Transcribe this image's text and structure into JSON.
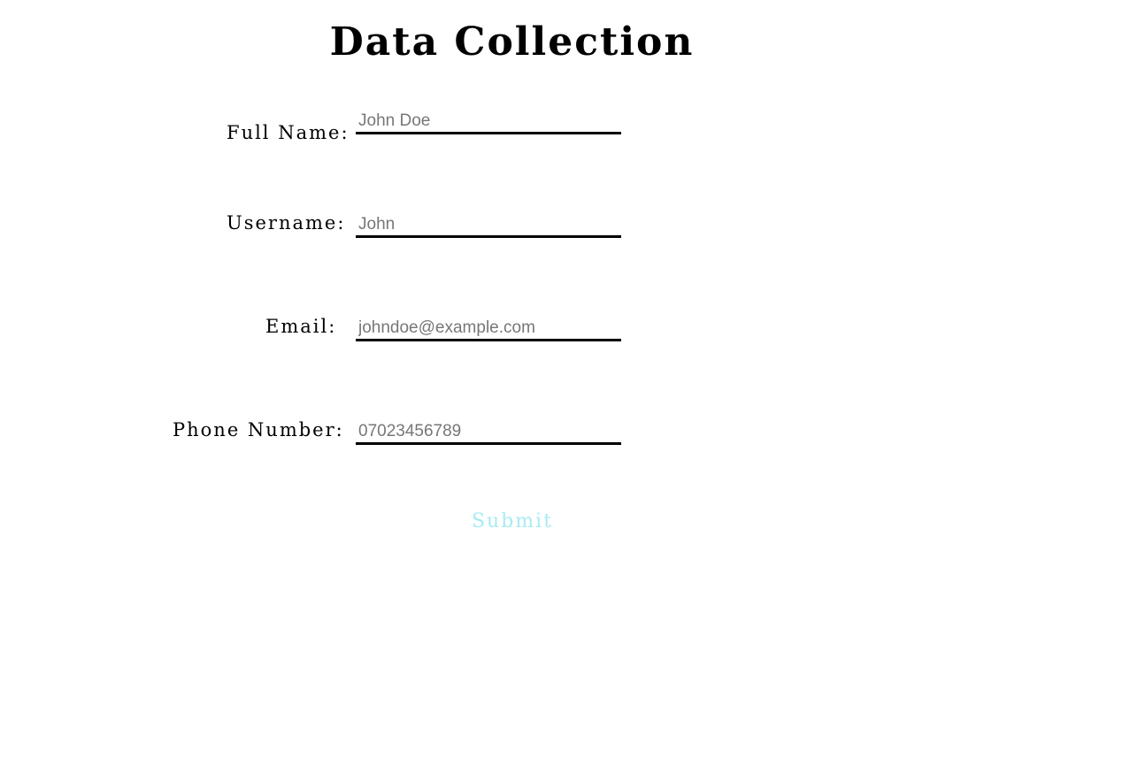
{
  "form": {
    "title": "Data Collection",
    "fields": [
      {
        "label": "Full Name:",
        "placeholder": "John Doe"
      },
      {
        "label": "Username:",
        "placeholder": "John"
      },
      {
        "label": "Email:",
        "placeholder": "johndoe@example.com"
      },
      {
        "label": "Phone Number:",
        "placeholder": "07023456789"
      }
    ],
    "submit_label": "Submit"
  },
  "colors": {
    "submit_text": "#a8ecf2",
    "placeholder_text": "#777777",
    "underline": "#000000"
  }
}
